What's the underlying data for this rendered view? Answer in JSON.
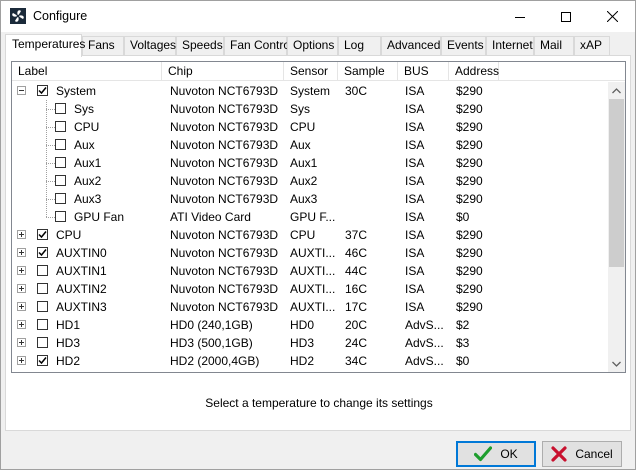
{
  "window": {
    "title": "Configure"
  },
  "tabs": [
    {
      "label": "Temperatures",
      "active": true
    },
    {
      "label": "Fans"
    },
    {
      "label": "Voltages"
    },
    {
      "label": "Speeds"
    },
    {
      "label": "Fan Control"
    },
    {
      "label": "Options"
    },
    {
      "label": "Log"
    },
    {
      "label": "Advanced"
    },
    {
      "label": "Events"
    },
    {
      "label": "Internet"
    },
    {
      "label": "Mail"
    },
    {
      "label": "xAP"
    }
  ],
  "columns": [
    "Label",
    "Chip",
    "Sensor",
    "Sample",
    "BUS",
    "Address"
  ],
  "rows": [
    {
      "label": "System",
      "chip": "Nuvoton NCT6793D",
      "sensor": "System",
      "sample": "30C",
      "bus": "ISA",
      "address": "$290",
      "checked": true,
      "level": 0,
      "expand": "minus"
    },
    {
      "label": "Sys",
      "chip": "Nuvoton NCT6793D",
      "sensor": "Sys",
      "sample": "",
      "bus": "ISA",
      "address": "$290",
      "checked": false,
      "level": 1,
      "expand": ""
    },
    {
      "label": "CPU",
      "chip": "Nuvoton NCT6793D",
      "sensor": "CPU",
      "sample": "",
      "bus": "ISA",
      "address": "$290",
      "checked": false,
      "level": 1,
      "expand": ""
    },
    {
      "label": "Aux",
      "chip": "Nuvoton NCT6793D",
      "sensor": "Aux",
      "sample": "",
      "bus": "ISA",
      "address": "$290",
      "checked": false,
      "level": 1,
      "expand": ""
    },
    {
      "label": "Aux1",
      "chip": "Nuvoton NCT6793D",
      "sensor": "Aux1",
      "sample": "",
      "bus": "ISA",
      "address": "$290",
      "checked": false,
      "level": 1,
      "expand": ""
    },
    {
      "label": "Aux2",
      "chip": "Nuvoton NCT6793D",
      "sensor": "Aux2",
      "sample": "",
      "bus": "ISA",
      "address": "$290",
      "checked": false,
      "level": 1,
      "expand": ""
    },
    {
      "label": "Aux3",
      "chip": "Nuvoton NCT6793D",
      "sensor": "Aux3",
      "sample": "",
      "bus": "ISA",
      "address": "$290",
      "checked": false,
      "level": 1,
      "expand": ""
    },
    {
      "label": "GPU Fan",
      "chip": "ATI Video Card",
      "sensor": "GPU F...",
      "sample": "",
      "bus": "ISA",
      "address": "$0",
      "checked": false,
      "level": 1,
      "expand": ""
    },
    {
      "label": "CPU",
      "chip": "Nuvoton NCT6793D",
      "sensor": "CPU",
      "sample": "37C",
      "bus": "ISA",
      "address": "$290",
      "checked": true,
      "level": 0,
      "expand": "plus"
    },
    {
      "label": "AUXTIN0",
      "chip": "Nuvoton NCT6793D",
      "sensor": "AUXTI...",
      "sample": "46C",
      "bus": "ISA",
      "address": "$290",
      "checked": true,
      "level": 0,
      "expand": "plus"
    },
    {
      "label": "AUXTIN1",
      "chip": "Nuvoton NCT6793D",
      "sensor": "AUXTI...",
      "sample": "44C",
      "bus": "ISA",
      "address": "$290",
      "checked": false,
      "level": 0,
      "expand": "plus"
    },
    {
      "label": "AUXTIN2",
      "chip": "Nuvoton NCT6793D",
      "sensor": "AUXTI...",
      "sample": "16C",
      "bus": "ISA",
      "address": "$290",
      "checked": false,
      "level": 0,
      "expand": "plus"
    },
    {
      "label": "AUXTIN3",
      "chip": "Nuvoton NCT6793D",
      "sensor": "AUXTI...",
      "sample": "17C",
      "bus": "ISA",
      "address": "$290",
      "checked": false,
      "level": 0,
      "expand": "plus"
    },
    {
      "label": "HD1",
      "chip": "HD0 (240,1GB)",
      "sensor": "HD0",
      "sample": "20C",
      "bus": "AdvS...",
      "address": "$2",
      "checked": false,
      "level": 0,
      "expand": "plus"
    },
    {
      "label": "HD3",
      "chip": "HD3 (500,1GB)",
      "sensor": "HD3",
      "sample": "24C",
      "bus": "AdvS...",
      "address": "$3",
      "checked": false,
      "level": 0,
      "expand": "plus"
    },
    {
      "label": "HD2",
      "chip": "HD2 (2000,4GB)",
      "sensor": "HD2",
      "sample": "34C",
      "bus": "AdvS...",
      "address": "$0",
      "checked": true,
      "level": 0,
      "expand": "plus"
    }
  ],
  "hint": "Select a temperature to change its settings",
  "buttons": {
    "ok": "OK",
    "cancel": "Cancel"
  },
  "colors": {
    "ok_check": "#1e9e2e",
    "cancel_x": "#c8102e",
    "accent": "#0078d7"
  }
}
